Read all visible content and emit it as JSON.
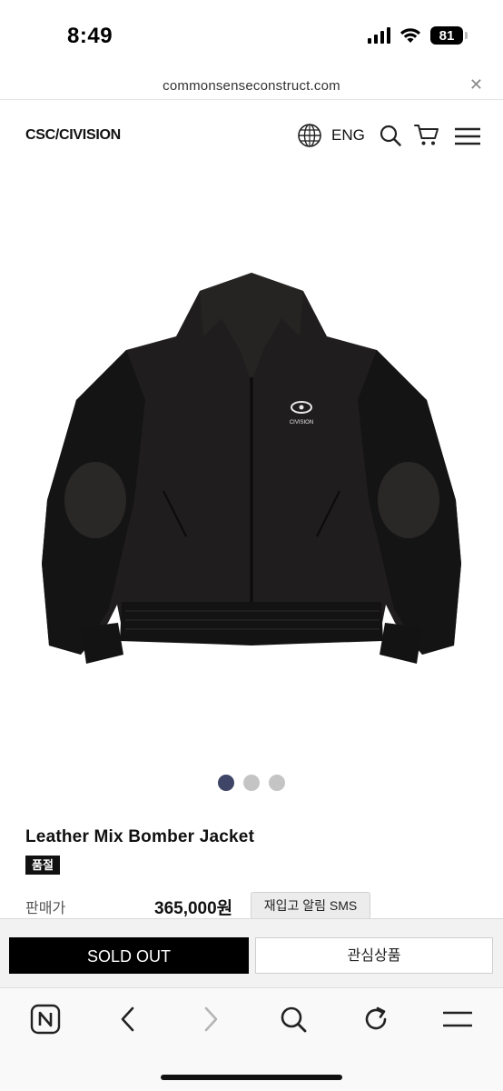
{
  "status_bar": {
    "time": "8:49",
    "battery": "81",
    "icons": [
      "signal-icon",
      "wifi-icon",
      "battery-icon"
    ]
  },
  "browser": {
    "url": "commonsenseconstruct.com",
    "close_icon": "close-icon"
  },
  "site_header": {
    "logo": "CSC/CIVISION",
    "language": "ENG",
    "icons": [
      "globe-icon",
      "search-icon",
      "cart-icon",
      "menu-icon"
    ]
  },
  "product": {
    "image_alt": "CIVISION",
    "title": "Leather Mix Bomber Jacket",
    "status_badge": "품절",
    "price_label": "판매가",
    "price": "365,000원",
    "restock_button": "재입고 알림 SMS"
  },
  "carousel": {
    "count": 3,
    "active_index": 0
  },
  "action_bar": {
    "soldout_label": "SOLD OUT",
    "wishlist_label": "관심상품"
  },
  "browser_toolbar": {
    "icons": [
      "naver-home-icon",
      "back-icon",
      "forward-icon",
      "search-icon",
      "reload-icon",
      "menu-icon"
    ]
  },
  "colors": {
    "accent_dot": "#3e4566",
    "soldout_bg": "#000000",
    "jacket": "#1f1d1d"
  }
}
